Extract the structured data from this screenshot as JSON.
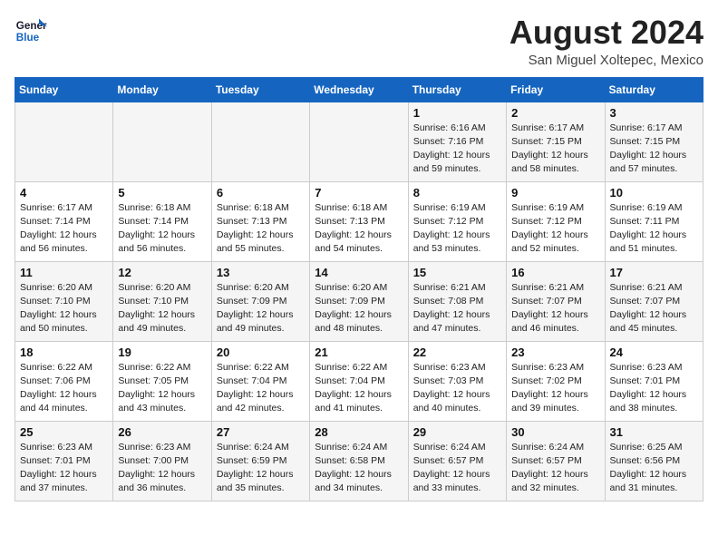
{
  "header": {
    "logo_line1": "General",
    "logo_line2": "Blue",
    "month_year": "August 2024",
    "location": "San Miguel Xoltepec, Mexico"
  },
  "days_of_week": [
    "Sunday",
    "Monday",
    "Tuesday",
    "Wednesday",
    "Thursday",
    "Friday",
    "Saturday"
  ],
  "weeks": [
    [
      {
        "day": "",
        "info": ""
      },
      {
        "day": "",
        "info": ""
      },
      {
        "day": "",
        "info": ""
      },
      {
        "day": "",
        "info": ""
      },
      {
        "day": "1",
        "info": "Sunrise: 6:16 AM\nSunset: 7:16 PM\nDaylight: 12 hours\nand 59 minutes."
      },
      {
        "day": "2",
        "info": "Sunrise: 6:17 AM\nSunset: 7:15 PM\nDaylight: 12 hours\nand 58 minutes."
      },
      {
        "day": "3",
        "info": "Sunrise: 6:17 AM\nSunset: 7:15 PM\nDaylight: 12 hours\nand 57 minutes."
      }
    ],
    [
      {
        "day": "4",
        "info": "Sunrise: 6:17 AM\nSunset: 7:14 PM\nDaylight: 12 hours\nand 56 minutes."
      },
      {
        "day": "5",
        "info": "Sunrise: 6:18 AM\nSunset: 7:14 PM\nDaylight: 12 hours\nand 56 minutes."
      },
      {
        "day": "6",
        "info": "Sunrise: 6:18 AM\nSunset: 7:13 PM\nDaylight: 12 hours\nand 55 minutes."
      },
      {
        "day": "7",
        "info": "Sunrise: 6:18 AM\nSunset: 7:13 PM\nDaylight: 12 hours\nand 54 minutes."
      },
      {
        "day": "8",
        "info": "Sunrise: 6:19 AM\nSunset: 7:12 PM\nDaylight: 12 hours\nand 53 minutes."
      },
      {
        "day": "9",
        "info": "Sunrise: 6:19 AM\nSunset: 7:12 PM\nDaylight: 12 hours\nand 52 minutes."
      },
      {
        "day": "10",
        "info": "Sunrise: 6:19 AM\nSunset: 7:11 PM\nDaylight: 12 hours\nand 51 minutes."
      }
    ],
    [
      {
        "day": "11",
        "info": "Sunrise: 6:20 AM\nSunset: 7:10 PM\nDaylight: 12 hours\nand 50 minutes."
      },
      {
        "day": "12",
        "info": "Sunrise: 6:20 AM\nSunset: 7:10 PM\nDaylight: 12 hours\nand 49 minutes."
      },
      {
        "day": "13",
        "info": "Sunrise: 6:20 AM\nSunset: 7:09 PM\nDaylight: 12 hours\nand 49 minutes."
      },
      {
        "day": "14",
        "info": "Sunrise: 6:20 AM\nSunset: 7:09 PM\nDaylight: 12 hours\nand 48 minutes."
      },
      {
        "day": "15",
        "info": "Sunrise: 6:21 AM\nSunset: 7:08 PM\nDaylight: 12 hours\nand 47 minutes."
      },
      {
        "day": "16",
        "info": "Sunrise: 6:21 AM\nSunset: 7:07 PM\nDaylight: 12 hours\nand 46 minutes."
      },
      {
        "day": "17",
        "info": "Sunrise: 6:21 AM\nSunset: 7:07 PM\nDaylight: 12 hours\nand 45 minutes."
      }
    ],
    [
      {
        "day": "18",
        "info": "Sunrise: 6:22 AM\nSunset: 7:06 PM\nDaylight: 12 hours\nand 44 minutes."
      },
      {
        "day": "19",
        "info": "Sunrise: 6:22 AM\nSunset: 7:05 PM\nDaylight: 12 hours\nand 43 minutes."
      },
      {
        "day": "20",
        "info": "Sunrise: 6:22 AM\nSunset: 7:04 PM\nDaylight: 12 hours\nand 42 minutes."
      },
      {
        "day": "21",
        "info": "Sunrise: 6:22 AM\nSunset: 7:04 PM\nDaylight: 12 hours\nand 41 minutes."
      },
      {
        "day": "22",
        "info": "Sunrise: 6:23 AM\nSunset: 7:03 PM\nDaylight: 12 hours\nand 40 minutes."
      },
      {
        "day": "23",
        "info": "Sunrise: 6:23 AM\nSunset: 7:02 PM\nDaylight: 12 hours\nand 39 minutes."
      },
      {
        "day": "24",
        "info": "Sunrise: 6:23 AM\nSunset: 7:01 PM\nDaylight: 12 hours\nand 38 minutes."
      }
    ],
    [
      {
        "day": "25",
        "info": "Sunrise: 6:23 AM\nSunset: 7:01 PM\nDaylight: 12 hours\nand 37 minutes."
      },
      {
        "day": "26",
        "info": "Sunrise: 6:23 AM\nSunset: 7:00 PM\nDaylight: 12 hours\nand 36 minutes."
      },
      {
        "day": "27",
        "info": "Sunrise: 6:24 AM\nSunset: 6:59 PM\nDaylight: 12 hours\nand 35 minutes."
      },
      {
        "day": "28",
        "info": "Sunrise: 6:24 AM\nSunset: 6:58 PM\nDaylight: 12 hours\nand 34 minutes."
      },
      {
        "day": "29",
        "info": "Sunrise: 6:24 AM\nSunset: 6:57 PM\nDaylight: 12 hours\nand 33 minutes."
      },
      {
        "day": "30",
        "info": "Sunrise: 6:24 AM\nSunset: 6:57 PM\nDaylight: 12 hours\nand 32 minutes."
      },
      {
        "day": "31",
        "info": "Sunrise: 6:25 AM\nSunset: 6:56 PM\nDaylight: 12 hours\nand 31 minutes."
      }
    ]
  ]
}
